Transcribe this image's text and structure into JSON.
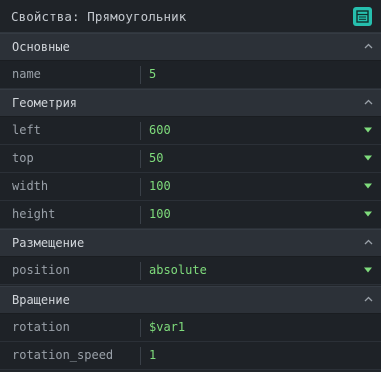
{
  "panel": {
    "title": "Свойства: Прямоугольник",
    "title_button_icon": "panel-layout-icon",
    "accent": "#26bfae",
    "value_color": "#7fdc7c"
  },
  "sections": [
    {
      "label": "Основные",
      "rows": [
        {
          "label": "name",
          "value": "5",
          "dropdown": false
        }
      ]
    },
    {
      "label": "Геометрия",
      "rows": [
        {
          "label": "left",
          "value": "600",
          "dropdown": true
        },
        {
          "label": "top",
          "value": "50",
          "dropdown": true
        },
        {
          "label": "width",
          "value": "100",
          "dropdown": true
        },
        {
          "label": "height",
          "value": "100",
          "dropdown": true
        }
      ]
    },
    {
      "label": "Размещение",
      "rows": [
        {
          "label": "position",
          "value": "absolute",
          "dropdown": true
        }
      ]
    },
    {
      "label": "Вращение",
      "rows": [
        {
          "label": "rotation",
          "value": "$var1",
          "dropdown": false
        },
        {
          "label": "rotation_speed",
          "value": "1",
          "dropdown": false
        }
      ]
    }
  ]
}
